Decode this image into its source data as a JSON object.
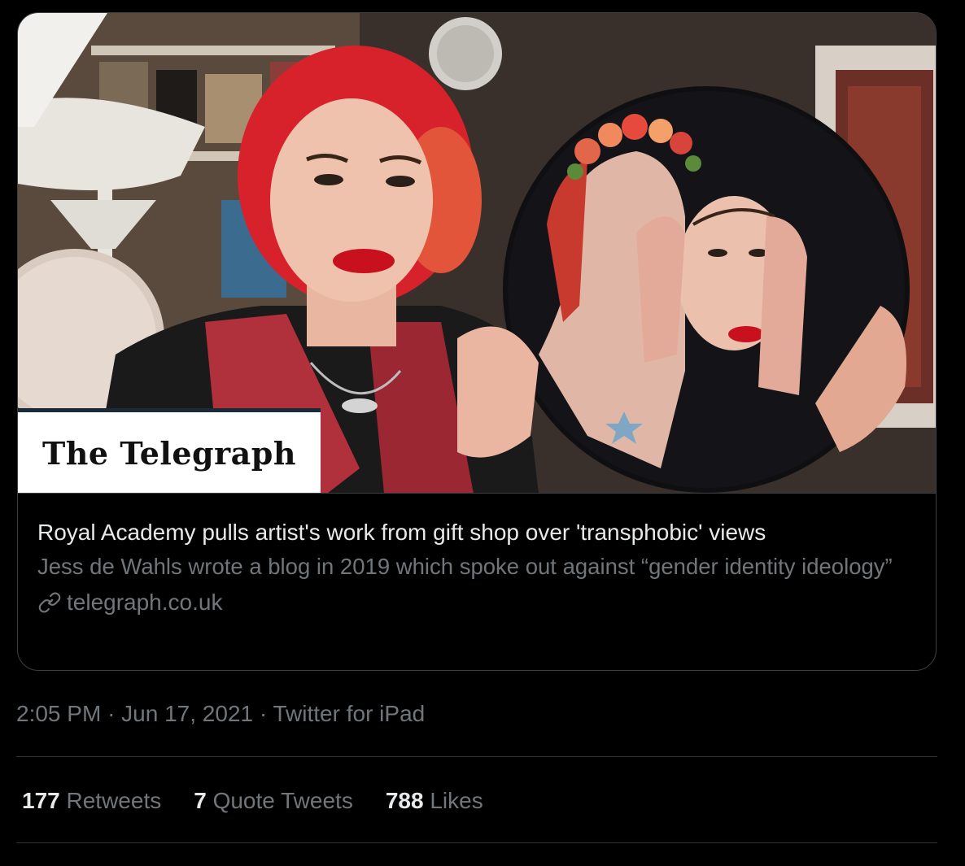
{
  "card": {
    "image": {
      "alt_logo_text": "The Telegraph"
    },
    "title": "Royal Academy pulls artist's work from gift shop over 'transphobic' views",
    "description": "Jess de Wahls wrote a blog in 2019 which spoke out against “gender identity ideology”",
    "domain": "telegraph.co.uk",
    "link_icon": "link-icon"
  },
  "meta": {
    "time": "2:05 PM",
    "separator": "·",
    "date": "Jun 17, 2021",
    "source": "Twitter for iPad"
  },
  "stats": {
    "retweets_count": "177",
    "retweets_label": "Retweets",
    "quotes_count": "7",
    "quotes_label": "Quote Tweets",
    "likes_count": "788",
    "likes_label": "Likes"
  },
  "colors": {
    "background": "#000000",
    "primary_text": "#e7e9ea",
    "secondary_text": "#71767b",
    "border": "#2f3336",
    "accent_hair": "#d8222b",
    "accent_lips": "#c8101e"
  }
}
